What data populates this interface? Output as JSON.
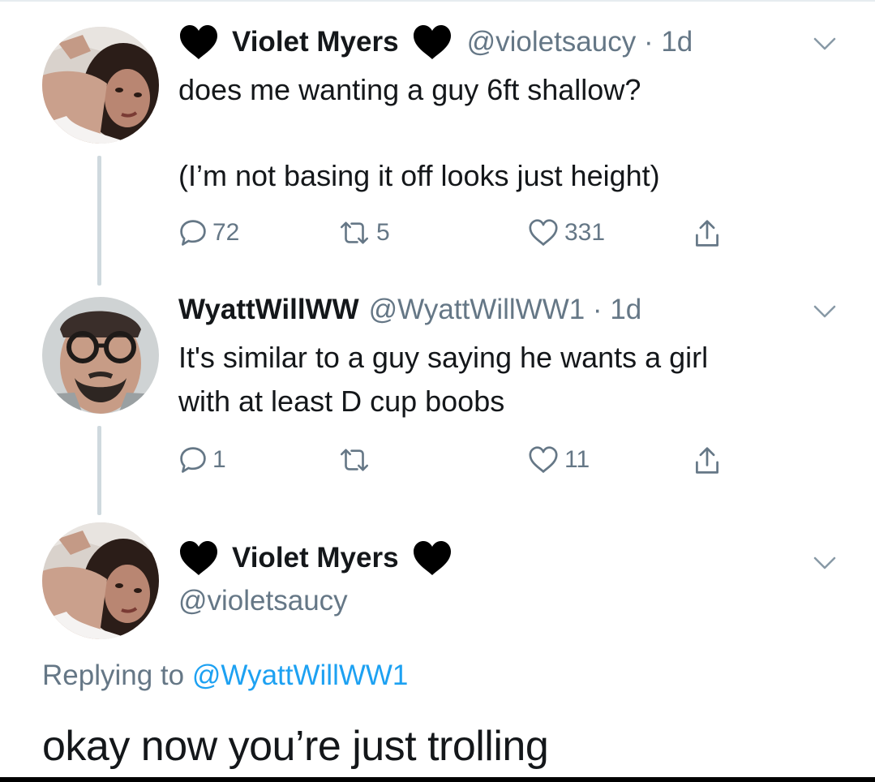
{
  "tweets": [
    {
      "name": "Violet Myers",
      "handle": "@violetsaucy",
      "dot": " · ",
      "time": "1d",
      "lines": [
        "does me wanting a guy 6ft shallow?",
        "(I’m not basing it off looks just height)"
      ],
      "replies": "72",
      "retweets": "5",
      "likes": "331"
    },
    {
      "name": "WyattWillWW",
      "handle": "@WyattWillWW1",
      "dot": " · ",
      "time": "1d",
      "lines": [
        "It's similar to a guy saying he wants a girl",
        "with at least D cup boobs"
      ],
      "replies": "1",
      "retweets": "",
      "likes": "11"
    }
  ],
  "main_tweet": {
    "name": "Violet Myers",
    "handle": "@violetsaucy",
    "replying_prefix": "Replying to ",
    "replying_mention": "@WyattWillWW1",
    "text": "okay now you’re just trolling"
  },
  "icons": [
    "black-heart-icon",
    "chevron-down-icon",
    "reply-icon",
    "retweet-icon",
    "like-icon",
    "share-icon"
  ],
  "colors": {
    "text": "#14171a",
    "secondary": "#657786",
    "link": "#1da1f2",
    "thread_line": "#cfd9de"
  }
}
